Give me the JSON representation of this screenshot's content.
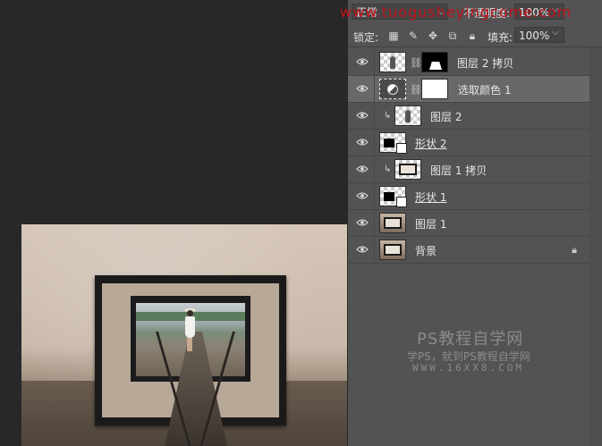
{
  "watermarks": {
    "top": "www.tuogusheyingcome.com",
    "brand": "PS教程自学网",
    "slogan": "学PS，就到PS教程自学网",
    "url": "WWW.16XX8.COM"
  },
  "panel": {
    "blend_mode": "正常",
    "opacity_label": "不透明度:",
    "opacity_value": "100%",
    "lock_label": "锁定:",
    "fill_label": "填充:",
    "fill_value": "100%",
    "lock_icons": [
      "checker-lock-icon",
      "brush-lock-icon",
      "move-lock-icon",
      "artboard-lock-icon",
      "padlock-icon"
    ]
  },
  "layers": [
    {
      "name": "图层 2 拷贝",
      "visible": true,
      "selected": false
    },
    {
      "name": "选取颜色 1",
      "visible": true,
      "selected": true
    },
    {
      "name": "图层 2",
      "visible": true,
      "selected": false,
      "clipped": true
    },
    {
      "name": "形状 2",
      "visible": true,
      "selected": false
    },
    {
      "name": "图层 1 拷贝",
      "visible": true,
      "selected": false,
      "clipped": true
    },
    {
      "name": "形状 1",
      "visible": true,
      "selected": false
    },
    {
      "name": "图层 1",
      "visible": true,
      "selected": false
    },
    {
      "name": "背景",
      "visible": true,
      "selected": false,
      "locked": true
    }
  ],
  "colors": {
    "panel_bg": "#535353",
    "selected_row": "#686868",
    "workspace": "#282828",
    "watermark_red": "#c0121a"
  }
}
